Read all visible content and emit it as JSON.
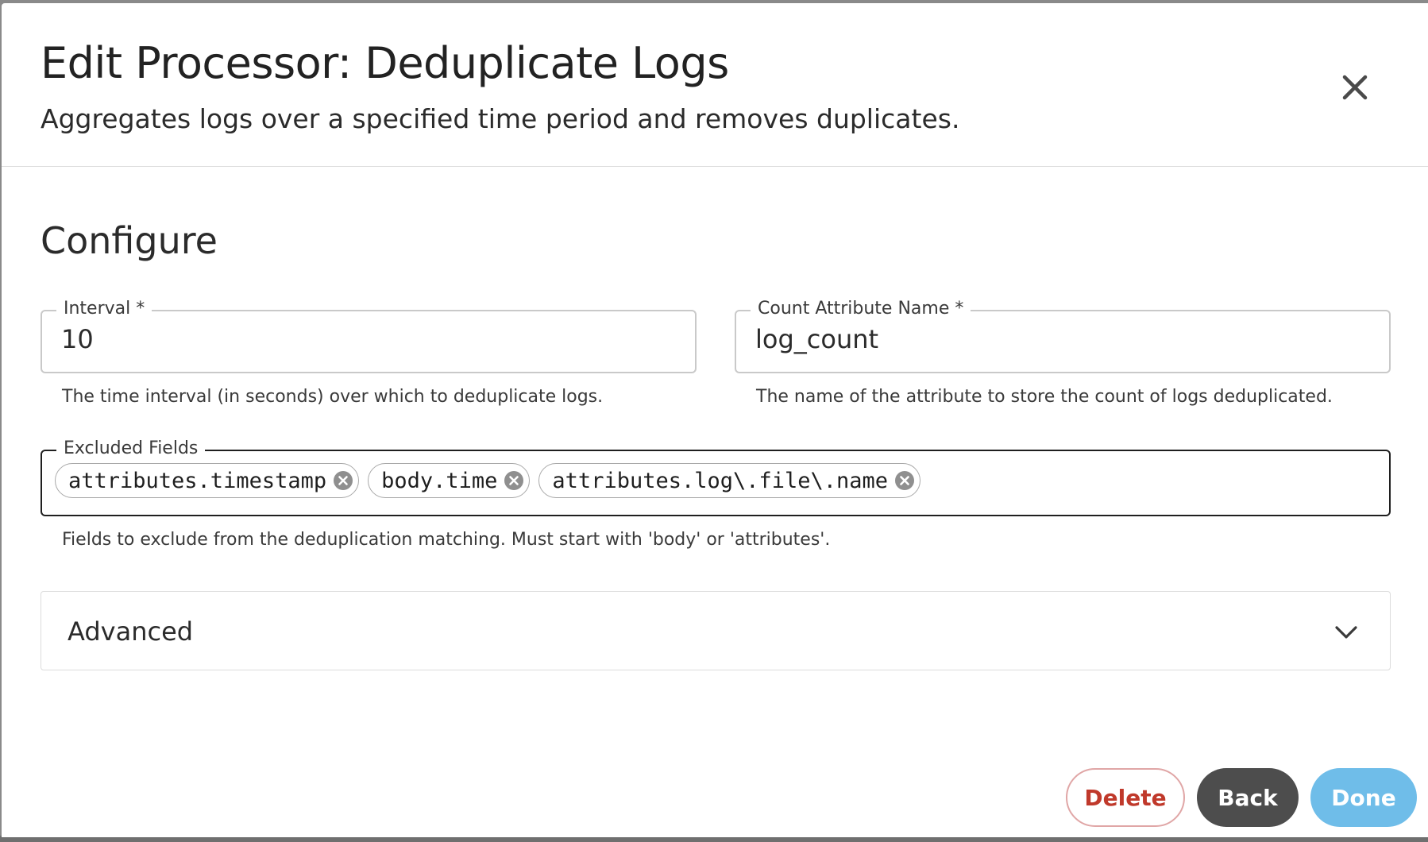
{
  "dialog": {
    "title": "Edit Processor: Deduplicate Logs",
    "subtitle": "Aggregates logs over a specified time period and removes duplicates."
  },
  "configure": {
    "heading": "Configure",
    "interval": {
      "label": "Interval *",
      "value": "10",
      "helper": "The time interval (in seconds) over which to deduplicate logs."
    },
    "count_attribute": {
      "label": "Count Attribute Name *",
      "value": "log_count",
      "helper": "The name of the attribute to store the count of logs deduplicated."
    },
    "excluded_fields": {
      "label": "Excluded Fields",
      "chips": [
        "attributes.timestamp",
        "body.time",
        "attributes.log\\.file\\.name"
      ],
      "helper": "Fields to exclude from the deduplication matching. Must start with 'body' or 'attributes'."
    },
    "advanced": {
      "label": "Advanced"
    }
  },
  "actions": {
    "delete": "Delete",
    "back": "Back",
    "done": "Done"
  },
  "colors": {
    "delete_text": "#c0392b",
    "back_bg": "#4d4d4d",
    "done_bg": "#6fbde9"
  },
  "icons": {
    "close": "close-icon",
    "chip_remove": "remove-chip-icon",
    "expand": "chevron-down-icon"
  }
}
